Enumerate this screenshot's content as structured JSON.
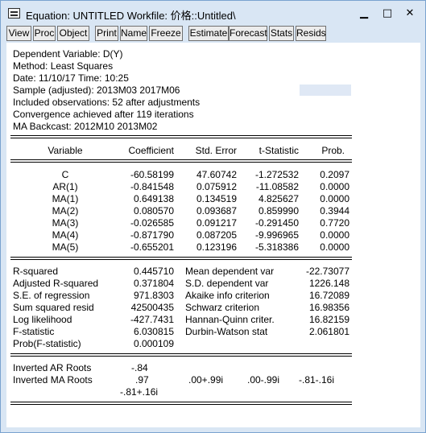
{
  "window": {
    "title": "Equation: UNTITLED   Workfile: 价格::Untitled\\",
    "minimize_glyph": "▁",
    "maximize_glyph": "□",
    "close_glyph": "✕"
  },
  "toolbar": {
    "buttons": [
      "View",
      "Proc",
      "Object",
      "Print",
      "Name",
      "Freeze",
      "Estimate",
      "Forecast",
      "Stats",
      "Resids"
    ]
  },
  "header_lines": [
    "Dependent Variable: D(Y)",
    "Method: Least Squares",
    "Date: 11/10/17   Time: 10:25",
    "Sample (adjusted): 2013M03 2017M06",
    "Included observations: 52 after adjustments",
    "Convergence achieved after 119 iterations",
    "MA Backcast: 2012M10 2013M02"
  ],
  "coef_table": {
    "columns": [
      "Variable",
      "Coefficient",
      "Std. Error",
      "t-Statistic",
      "Prob."
    ],
    "rows": [
      [
        "C",
        "-60.58199",
        "47.60742",
        "-1.272532",
        "0.2097"
      ],
      [
        "AR(1)",
        "-0.841548",
        "0.075912",
        "-11.08582",
        "0.0000"
      ],
      [
        "MA(1)",
        "0.649138",
        "0.134519",
        "4.825627",
        "0.0000"
      ],
      [
        "MA(2)",
        "0.080570",
        "0.093687",
        "0.859990",
        "0.3944"
      ],
      [
        "MA(3)",
        "-0.026585",
        "0.091217",
        "-0.291450",
        "0.7720"
      ],
      [
        "MA(4)",
        "-0.871790",
        "0.087205",
        "-9.996965",
        "0.0000"
      ],
      [
        "MA(5)",
        "-0.655201",
        "0.123196",
        "-5.318386",
        "0.0000"
      ]
    ]
  },
  "stats": {
    "left": [
      [
        "R-squared",
        "0.445710"
      ],
      [
        "Adjusted R-squared",
        "0.371804"
      ],
      [
        "S.E. of regression",
        "971.8303"
      ],
      [
        "Sum squared resid",
        "42500435"
      ],
      [
        "Log likelihood",
        "-427.7431"
      ],
      [
        "F-statistic",
        "6.030815"
      ],
      [
        "Prob(F-statistic)",
        "0.000109"
      ]
    ],
    "right": [
      [
        "Mean dependent var",
        "-22.73077"
      ],
      [
        "S.D. dependent var",
        "1226.148"
      ],
      [
        "Akaike info criterion",
        "16.72089"
      ],
      [
        "Schwarz criterion",
        "16.98356"
      ],
      [
        "Hannan-Quinn criter.",
        "16.82159"
      ],
      [
        "Durbin-Watson stat",
        "2.061801"
      ]
    ]
  },
  "roots": {
    "ar_label": "Inverted AR Roots",
    "ar_values": [
      "-.84"
    ],
    "ma_label": "Inverted MA Roots",
    "ma_values": [
      ".97",
      ".00+.99i",
      ".00-.99i",
      "-.81-.16i",
      "-.81+.16i"
    ]
  }
}
